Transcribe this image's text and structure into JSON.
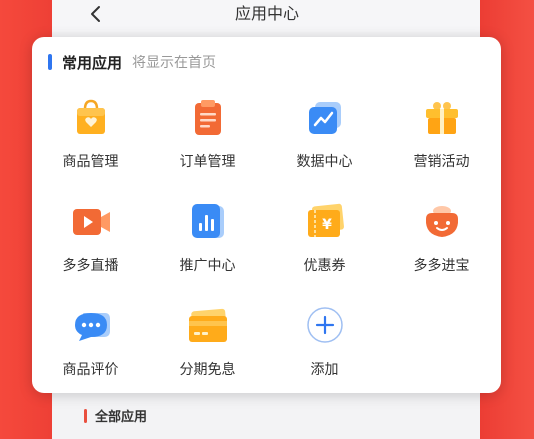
{
  "header": {
    "title": "应用中心"
  },
  "common_section": {
    "title": "常用应用",
    "subtitle": "将显示在首页"
  },
  "apps": [
    {
      "label": "商品管理",
      "icon": "shopping-bag-icon"
    },
    {
      "label": "订单管理",
      "icon": "clipboard-icon"
    },
    {
      "label": "数据中心",
      "icon": "chart-line-icon"
    },
    {
      "label": "营销活动",
      "icon": "gift-box-icon"
    },
    {
      "label": "多多直播",
      "icon": "video-camera-icon"
    },
    {
      "label": "推广中心",
      "icon": "bar-chart-icon"
    },
    {
      "label": "优惠券",
      "icon": "coupon-icon"
    },
    {
      "label": "多多进宝",
      "icon": "money-pouch-icon"
    },
    {
      "label": "商品评价",
      "icon": "chat-bubble-icon"
    },
    {
      "label": "分期免息",
      "icon": "credit-card-icon"
    },
    {
      "label": "添加",
      "icon": "add-icon"
    }
  ],
  "all_section": {
    "title": "全部应用"
  },
  "colors": {
    "accent": "#2f76f0",
    "brand": "#f2453a"
  }
}
